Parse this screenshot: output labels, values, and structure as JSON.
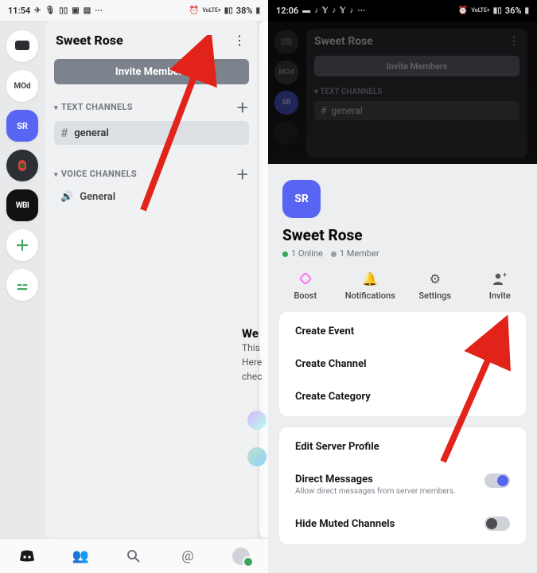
{
  "left": {
    "statusbar": {
      "time": "11:54",
      "battery": "38%",
      "net": "VoLTE+"
    },
    "servers": {
      "dm": "",
      "mod": "MOd",
      "sr": "SR",
      "wbi": "WBI"
    },
    "server_title": "Sweet Rose",
    "invite_btn": "Invite Members",
    "text_channels_label": "TEXT CHANNELS",
    "voice_channels_label": "VOICE CHANNELS",
    "channel_general": "general",
    "voice_general": "General",
    "peek": {
      "l1": "We",
      "l2": "This",
      "l3": "Here",
      "l4": "chec"
    }
  },
  "right": {
    "statusbar": {
      "time": "12:06",
      "battery": "36%",
      "net": "VoLTE+"
    },
    "dim": {
      "title": "Sweet Rose",
      "invite": "Invite Members",
      "tc": "TEXT CHANNELS",
      "general": "general",
      "mod": "MOd",
      "sr": "SR"
    },
    "sheet": {
      "badge": "SR",
      "title": "Sweet Rose",
      "online": "1 Online",
      "members": "1 Member",
      "actions": {
        "boost": "Boost",
        "notif": "Notifications",
        "settings": "Settings",
        "invite": "Invite"
      },
      "rows": {
        "create_event": "Create Event",
        "create_channel": "Create Channel",
        "create_category": "Create Category",
        "edit_profile": "Edit Server Profile",
        "dm": "Direct Messages",
        "dm_sub": "Allow direct messages from server members.",
        "hide_muted": "Hide Muted Channels"
      }
    }
  }
}
